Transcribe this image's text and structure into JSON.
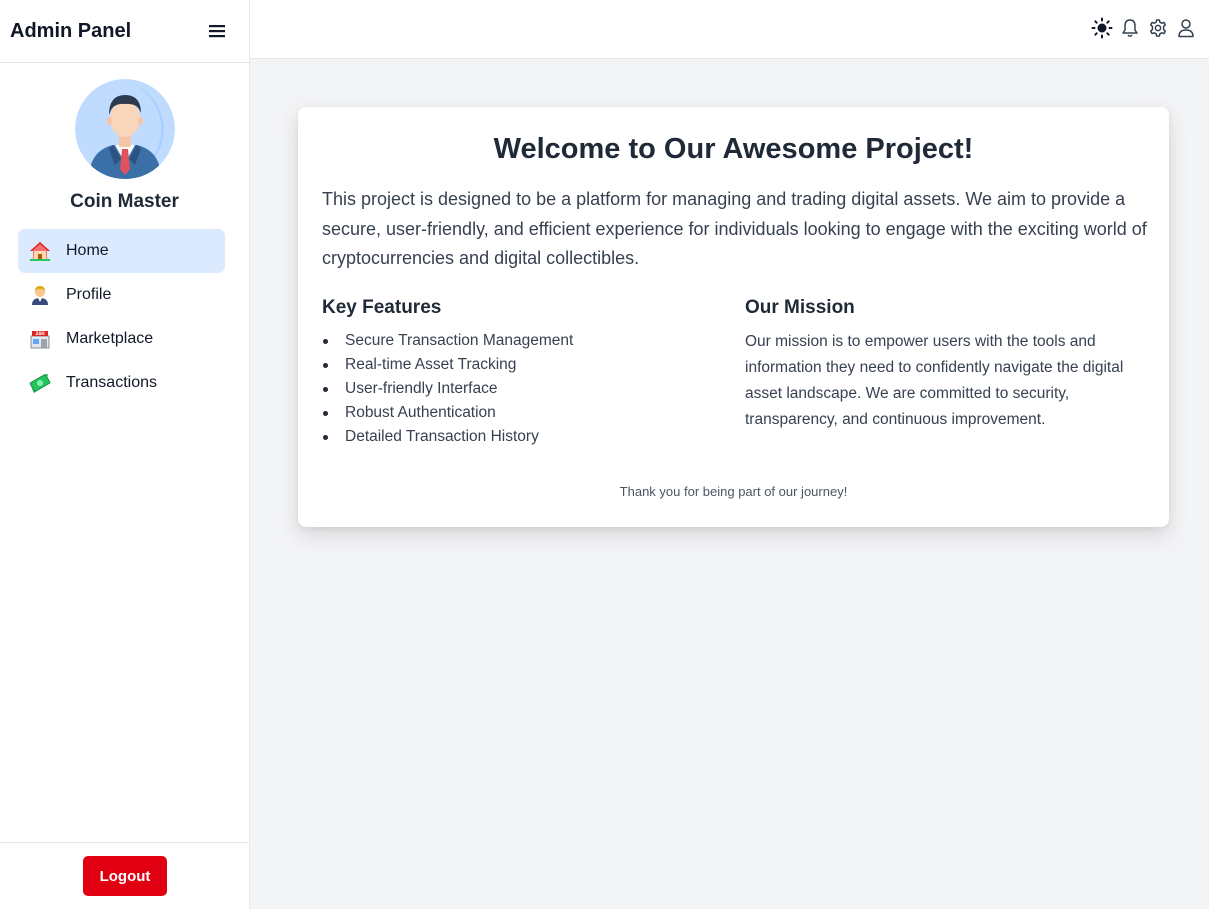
{
  "sidebar": {
    "brand": "Admin Panel",
    "menu_icon": "hamburger-icon",
    "user": {
      "name": "Coin Master",
      "avatar_icon": "businessman-avatar"
    },
    "items": [
      {
        "label": "Home",
        "icon": "house-icon",
        "active": true
      },
      {
        "label": "Profile",
        "icon": "person-icon",
        "active": false
      },
      {
        "label": "Marketplace",
        "icon": "store-icon",
        "active": false
      },
      {
        "label": "Transactions",
        "icon": "money-icon",
        "active": false
      }
    ],
    "logout_label": "Logout"
  },
  "topbar": {
    "icons": [
      "sun-icon",
      "bell-icon",
      "gear-icon",
      "user-icon"
    ]
  },
  "main": {
    "title": "Welcome to Our Awesome Project!",
    "intro": "This project is designed to be a platform for managing and trading digital assets. We aim to provide a secure, user-friendly, and efficient experience for individuals looking to engage with the exciting world of cryptocurrencies and digital collectibles.",
    "features": {
      "heading": "Key Features",
      "items": [
        "Secure Transaction Management",
        "Real-time Asset Tracking",
        "User-friendly Interface",
        "Robust Authentication",
        "Detailed Transaction History"
      ]
    },
    "mission": {
      "heading": "Our Mission",
      "text": "Our mission is to empower users with the tools and information they need to confidently navigate the digital asset landscape. We are committed to security, transparency, and continuous improvement."
    },
    "footer": "Thank you for being part of our journey!"
  },
  "colors": {
    "active_nav_bg": "#dbeafe",
    "logout_bg": "#e00012",
    "page_bg": "#f3f4f6"
  }
}
